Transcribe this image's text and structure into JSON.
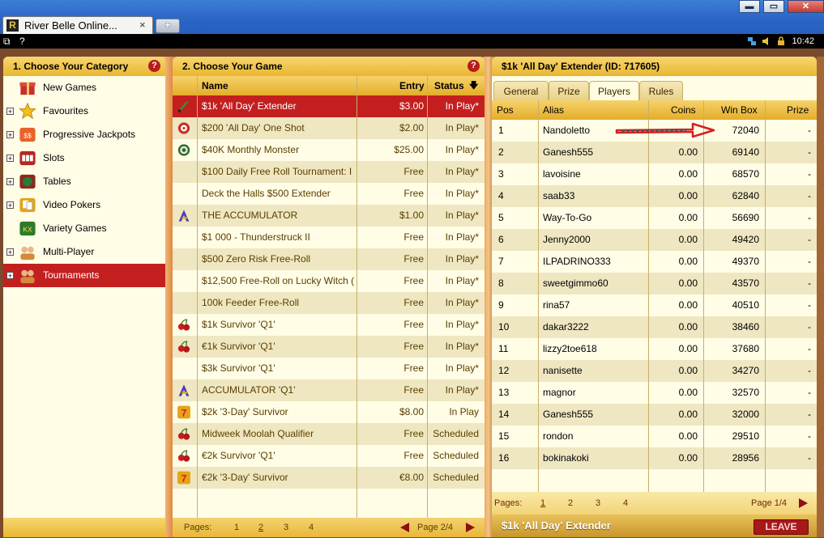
{
  "window": {
    "tab_title": "River Belle Online...",
    "tab_close": "×",
    "new_tab": "+",
    "logo_letter": "R",
    "min_glyph": "▬",
    "max_glyph": "▭",
    "close_glyph": "✕"
  },
  "menubar": {
    "item1": "⧉",
    "item2": "?",
    "clock": "10:42"
  },
  "categories_panel": {
    "title": "1. Choose Your Category",
    "help": "?",
    "items": [
      {
        "label": "New Games",
        "expandable": false,
        "icon": "gift-icon",
        "color": "#d84a3a"
      },
      {
        "label": "Favourites",
        "expandable": true,
        "icon": "star-icon",
        "color": "#f2b31c"
      },
      {
        "label": "Progressive Jackpots",
        "expandable": true,
        "icon": "jackpot-icon",
        "color": "#d4452a"
      },
      {
        "label": "Slots",
        "expandable": true,
        "icon": "slots-icon",
        "color": "#c0392b"
      },
      {
        "label": "Tables",
        "expandable": true,
        "icon": "tables-icon",
        "color": "#8e2b1e"
      },
      {
        "label": "Video Pokers",
        "expandable": true,
        "icon": "video-poker-icon",
        "color": "#e3a21a"
      },
      {
        "label": "Variety Games",
        "expandable": false,
        "icon": "variety-icon",
        "color": "#3d8a2a"
      },
      {
        "label": "Multi-Player",
        "expandable": true,
        "icon": "multiplayer-icon",
        "color": "#d9a070"
      },
      {
        "label": "Tournaments",
        "expandable": true,
        "icon": "tournaments-icon",
        "color": "#d9a070",
        "selected": true
      }
    ]
  },
  "games_panel": {
    "title": "2. Choose Your Game",
    "help": "?",
    "columns": {
      "name": "Name",
      "entry": "Entry",
      "status": "Status",
      "sort_glyph": "🡇"
    },
    "rows": [
      {
        "name": "$1k 'All Day' Extender",
        "entry": "$3.00",
        "status": "In Play*",
        "icon": "sword-icon",
        "selected": true
      },
      {
        "name": "$200 'All Day' One Shot",
        "entry": "$2.00",
        "status": "In Play*",
        "icon": "target-icon"
      },
      {
        "name": "$40K Monthly Monster",
        "entry": "$25.00",
        "status": "In Play*",
        "icon": "eye-icon"
      },
      {
        "name": "$100 Daily Free Roll Tournament: I",
        "entry": "Free",
        "status": "In Play*",
        "icon": ""
      },
      {
        "name": "Deck the Halls $500 Extender",
        "entry": "Free",
        "status": "In Play*",
        "icon": ""
      },
      {
        "name": "THE ACCUMULATOR",
        "entry": "$1.00",
        "status": "In Play*",
        "icon": "accumulator-icon"
      },
      {
        "name": "$1 000 - Thunderstruck II",
        "entry": "Free",
        "status": "In Play*",
        "icon": ""
      },
      {
        "name": "$500 Zero Risk Free-Roll",
        "entry": "Free",
        "status": "In Play*",
        "icon": ""
      },
      {
        "name": "$12,500 Free-Roll on Lucky Witch (",
        "entry": "Free",
        "status": "In Play*",
        "icon": ""
      },
      {
        "name": "100k Feeder Free-Roll",
        "entry": "Free",
        "status": "In Play*",
        "icon": ""
      },
      {
        "name": "$1k Survivor 'Q1'",
        "entry": "Free",
        "status": "In Play*",
        "icon": "cherry-icon"
      },
      {
        "name": "€1k Survivor 'Q1'",
        "entry": "Free",
        "status": "In Play*",
        "icon": "cherry-icon"
      },
      {
        "name": "$3k Survivor 'Q1'",
        "entry": "Free",
        "status": "In Play*",
        "icon": ""
      },
      {
        "name": "ACCUMULATOR 'Q1'",
        "entry": "Free",
        "status": "In Play*",
        "icon": "accumulator-icon"
      },
      {
        "name": "$2k '3-Day' Survivor",
        "entry": "$8.00",
        "status": "In Play",
        "icon": "seven-icon"
      },
      {
        "name": "Midweek Moolah Qualifier",
        "entry": "Free",
        "status": "Scheduled",
        "icon": "cherry-icon"
      },
      {
        "name": "€2k Survivor 'Q1'",
        "entry": "Free",
        "status": "Scheduled",
        "icon": "cherry-icon"
      },
      {
        "name": "€2k '3-Day' Survivor",
        "entry": "€8.00",
        "status": "Scheduled",
        "icon": "seven-icon"
      }
    ],
    "footer": {
      "label": "Pages:",
      "pages": [
        "1",
        "2",
        "3",
        "4"
      ],
      "current": "2",
      "page_of": "Page 2/4"
    }
  },
  "details_panel": {
    "title": "$1k 'All Day' Extender (ID: 717605)",
    "tabs": [
      "General",
      "Prize",
      "Players",
      "Rules"
    ],
    "active_tab": "Players",
    "columns": {
      "pos": "Pos",
      "alias": "Alias",
      "coins": "Coins",
      "winbox": "Win Box",
      "prize": "Prize"
    },
    "players": [
      {
        "pos": "1",
        "alias": "Nandoletto",
        "coins": "",
        "winbox": "72040",
        "prize": "-"
      },
      {
        "pos": "2",
        "alias": "Ganesh555",
        "coins": "0.00",
        "winbox": "69140",
        "prize": "-"
      },
      {
        "pos": "3",
        "alias": "lavoisine",
        "coins": "0.00",
        "winbox": "68570",
        "prize": "-"
      },
      {
        "pos": "4",
        "alias": "saab33",
        "coins": "0.00",
        "winbox": "62840",
        "prize": "-"
      },
      {
        "pos": "5",
        "alias": "Way-To-Go",
        "coins": "0.00",
        "winbox": "56690",
        "prize": "-"
      },
      {
        "pos": "6",
        "alias": "Jenny2000",
        "coins": "0.00",
        "winbox": "49420",
        "prize": "-"
      },
      {
        "pos": "7",
        "alias": "ILPADRINO333",
        "coins": "0.00",
        "winbox": "49370",
        "prize": "-"
      },
      {
        "pos": "8",
        "alias": "sweetgimmo60",
        "coins": "0.00",
        "winbox": "43570",
        "prize": "-"
      },
      {
        "pos": "9",
        "alias": "rina57",
        "coins": "0.00",
        "winbox": "40510",
        "prize": "-"
      },
      {
        "pos": "10",
        "alias": "dakar3222",
        "coins": "0.00",
        "winbox": "38460",
        "prize": "-"
      },
      {
        "pos": "11",
        "alias": "lizzy2toe618",
        "coins": "0.00",
        "winbox": "37680",
        "prize": "-"
      },
      {
        "pos": "12",
        "alias": "nanisette",
        "coins": "0.00",
        "winbox": "34270",
        "prize": "-"
      },
      {
        "pos": "13",
        "alias": "magnor",
        "coins": "0.00",
        "winbox": "32570",
        "prize": "-"
      },
      {
        "pos": "14",
        "alias": "Ganesh555",
        "coins": "0.00",
        "winbox": "32000",
        "prize": "-"
      },
      {
        "pos": "15",
        "alias": "rondon",
        "coins": "0.00",
        "winbox": "29510",
        "prize": "-"
      },
      {
        "pos": "16",
        "alias": "bokinakoki",
        "coins": "0.00",
        "winbox": "28956",
        "prize": "-"
      }
    ],
    "footer": {
      "label": "Pages:",
      "pages": [
        "1",
        "2",
        "3",
        "4"
      ],
      "current": "1",
      "page_of": "Page 1/4"
    },
    "bottom_title": "$1k 'All Day' Extender",
    "leave_label": "LEAVE"
  },
  "colors": {
    "selected_row": "#c41f1f",
    "header_gold": "#e9b631",
    "panel_bg": "#fffde6",
    "annotation_red": "#d81e1e"
  }
}
